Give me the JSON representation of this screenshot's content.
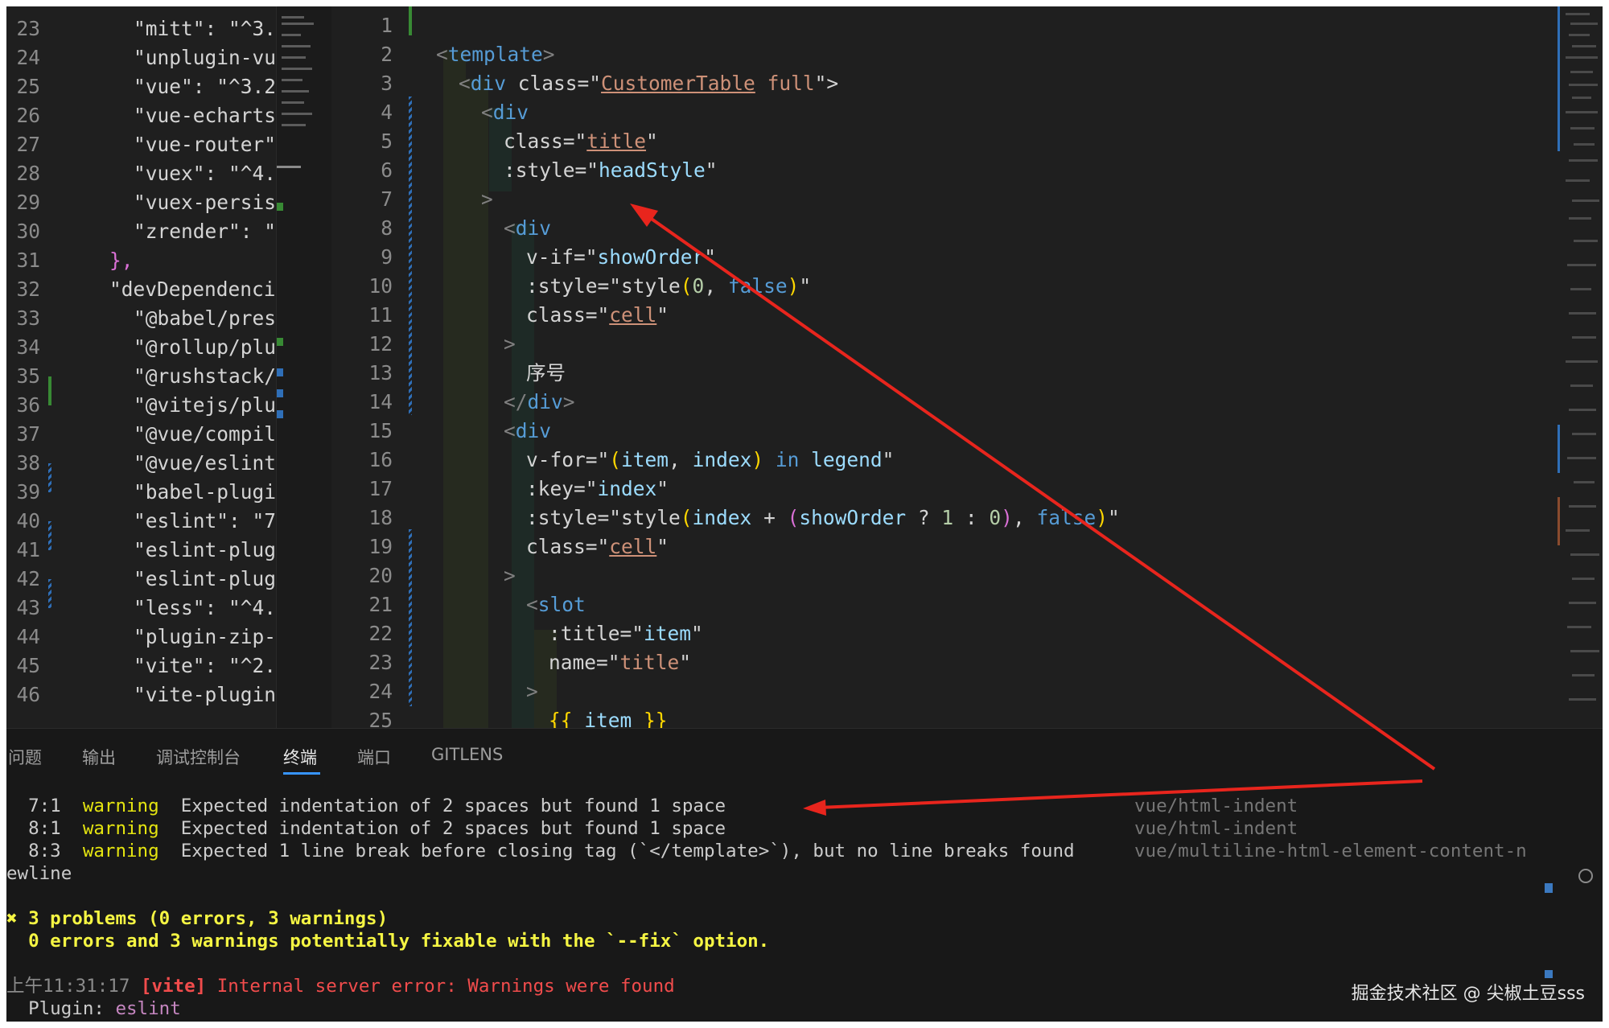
{
  "left_editor": {
    "lines": [
      {
        "num": "23",
        "code": "\"mitt\": \"^3.("
      },
      {
        "num": "24",
        "code": "\"unplugin-vu"
      },
      {
        "num": "25",
        "code": "\"vue\": \"^3.2"
      },
      {
        "num": "26",
        "code": "\"vue-echarts\""
      },
      {
        "num": "27",
        "code": "\"vue-router\""
      },
      {
        "num": "28",
        "code": "\"vuex\": \"^4.("
      },
      {
        "num": "29",
        "code": "\"vuex-persis"
      },
      {
        "num": "30",
        "code": "\"zrender\": \"'"
      },
      {
        "num": "31",
        "code": "},"
      },
      {
        "num": "32",
        "code": "\"devDependenci"
      },
      {
        "num": "33",
        "code": "\"@babel/pres"
      },
      {
        "num": "34",
        "code": "\"@rollup/plu"
      },
      {
        "num": "35",
        "code": "\"@rushstack/"
      },
      {
        "num": "36",
        "code": "\"@vitejs/plu"
      },
      {
        "num": "37",
        "code": "\"@vue/compil"
      },
      {
        "num": "38",
        "code": "\"@vue/eslint-"
      },
      {
        "num": "39",
        "code": "\"babel-plugi"
      },
      {
        "num": "40",
        "code": "\"eslint\": \"7"
      },
      {
        "num": "41",
        "code": "\"eslint-plug"
      },
      {
        "num": "42",
        "code": "\"eslint-plug"
      },
      {
        "num": "43",
        "code": "\"less\": \"^4.:"
      },
      {
        "num": "44",
        "code": "\"plugin-zip-p"
      },
      {
        "num": "45",
        "code": "\"vite\": \"^2.("
      },
      {
        "num": "46",
        "code": "\"vite-plugin-"
      }
    ]
  },
  "editor": {
    "line_numbers": [
      "1",
      "2",
      "3",
      "4",
      "5",
      "6",
      "7",
      "8",
      "9",
      "10",
      "11",
      "12",
      "13",
      "14",
      "15",
      "16",
      "17",
      "18",
      "19",
      "20",
      "21",
      "22",
      "23",
      "24",
      "25"
    ],
    "l2": {
      "open": "<",
      "tag": "template",
      "close": ">"
    },
    "l3": {
      "open": "<",
      "tag": "div",
      "attr": " class=\"",
      "v1": "CustomerTable",
      "v2": " full",
      "end": "\">"
    },
    "l4": {
      "open": "<",
      "tag": "div"
    },
    "l5": {
      "attr": "class=\"",
      "val": "title",
      "end": "\""
    },
    "l6": {
      "attr": ":style=\"",
      "val": "headStyle",
      "end": "\""
    },
    "l7": {
      "text": ">"
    },
    "l8": {
      "open": "<",
      "tag": "div"
    },
    "l9": {
      "attr": "v-if=\"",
      "val": "showOrder",
      "end": "\""
    },
    "l10": {
      "attr": ":style=\"",
      "fn": "style",
      "p1": "(",
      "n": "0",
      "comma": ", ",
      "kw": "false",
      "p2": ")",
      "end": "\""
    },
    "l11": {
      "attr": "class=\"",
      "val": "cell",
      "end": "\""
    },
    "l12": {
      "text": ">"
    },
    "l13": {
      "text": "序号"
    },
    "l14": {
      "open": "</",
      "tag": "div",
      "close": ">"
    },
    "l15": {
      "open": "<",
      "tag": "div"
    },
    "l16": {
      "attr": "v-for=\"",
      "p1": "(",
      "a": "item",
      "comma": ", ",
      "b": "index",
      "p2": ")",
      "kw": " in ",
      "c": "legend",
      "end": "\""
    },
    "l17": {
      "attr": ":key=\"",
      "val": "index",
      "end": "\""
    },
    "l18": {
      "attr": ":style=\"",
      "fn": "style",
      "p1": "(",
      "a": "index",
      "plus": " + ",
      "p2": "(",
      "b": "showOrder",
      "q": " ? ",
      "n1": "1",
      "colon": " : ",
      "n0": "0",
      "p3": ")",
      "comma": ", ",
      "kw": "false",
      "p4": ")",
      "end": "\""
    },
    "l19": {
      "attr": "class=\"",
      "val": "cell",
      "end": "\""
    },
    "l20": {
      "text": ">"
    },
    "l21": {
      "open": "<",
      "tag": "slot"
    },
    "l22": {
      "attr": ":title=\"",
      "val": "item",
      "end": "\""
    },
    "l23": {
      "attr": "name=\"",
      "val": "title",
      "end": "\""
    },
    "l24": {
      "text": ">"
    },
    "l25": {
      "b1": "{{",
      "val": " item ",
      "b2": "}}"
    }
  },
  "panel": {
    "tabs": [
      "问题",
      "输出",
      "调试控制台",
      "终端",
      "端口",
      "GITLENS"
    ],
    "active_tab": "终端",
    "warnings": [
      {
        "pos": "7:1",
        "level": "warning",
        "message": "Expected indentation of 2 spaces but found 1 space",
        "rule": "vue/html-indent"
      },
      {
        "pos": "8:1",
        "level": "warning",
        "message": "Expected indentation of 2 spaces but found 1 space",
        "rule": "vue/html-indent"
      },
      {
        "pos": "8:3",
        "level": "warning",
        "message": "Expected 1 line break before closing tag (`</template>`), but no line breaks found",
        "rule": "vue/multiline-html-element-content-n"
      }
    ],
    "wrap_rest": "ewline",
    "summary": "✖ 3 problems (0 errors, 3 warnings)",
    "fixable": "  0 errors and 3 warnings potentially fixable with the `--fix` option.",
    "log_time": "上午11:31:17",
    "log_tag": "[vite]",
    "log_msg": " Internal server error: Warnings were found",
    "plugin_label": "  Plugin: ",
    "plugin_name": "eslint"
  },
  "watermark": "掘金技术社区 @ 尖椒土豆sss",
  "colors": {
    "arrow": "#e8251d",
    "warning": "#e5e510",
    "summary": "#f5f543",
    "error": "#f14c4c",
    "active_tab_underline": "#3794ff"
  }
}
